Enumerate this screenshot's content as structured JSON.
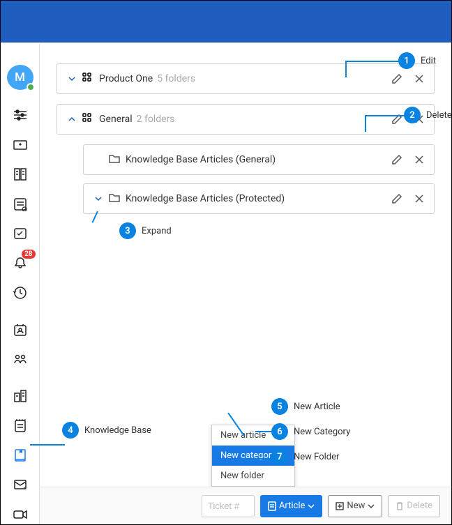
{
  "avatar": {
    "initial": "M"
  },
  "notifications": {
    "count": "28"
  },
  "categories": [
    {
      "name": "Product One",
      "sub": "5 folders",
      "expanded": false
    },
    {
      "name": "General",
      "sub": "2 folders",
      "expanded": true
    }
  ],
  "folders": [
    {
      "name": "Knowledge Base Articles (General)",
      "hasChildren": false
    },
    {
      "name": "Knowledge Base Articles (Protected)",
      "hasChildren": true
    }
  ],
  "dropdown": {
    "items": [
      "New article",
      "New category",
      "New folder"
    ],
    "selectedIndex": 1
  },
  "toolbar": {
    "ticket_placeholder": "Ticket #",
    "article_label": "Article",
    "new_label": "New",
    "delete_label": "Delete"
  },
  "callouts": {
    "1": "Edit",
    "2": "Delete",
    "3": "Expand",
    "4": "Knowledge Base",
    "5": "New Article",
    "6": "New Category",
    "7": "New Folder"
  }
}
